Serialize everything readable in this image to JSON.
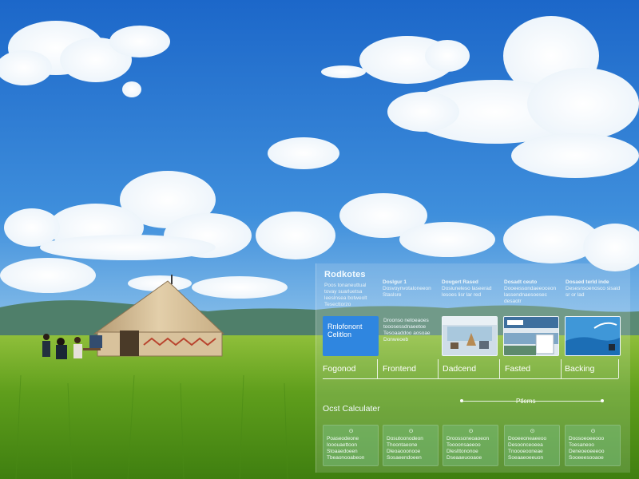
{
  "colors": {
    "sky_top": "#1f6fcf",
    "sky_bottom": "#8fc3ec",
    "grass": "#6aa81f",
    "panel_accent": "#2f86e0"
  },
  "scene": {
    "icons": [
      "yurt-icon",
      "people-icon",
      "cloud-icon"
    ]
  },
  "panel": {
    "title": "Rodkotes",
    "intro": "Poos tonaneuttual tovay suarluetsa leeslnsea botweolt Tesecttorzo",
    "stages": [
      {
        "head": "Doslgur 1",
        "desc": "Dosvoynvotaloneeon Staslsre",
        "card_text": "Rnlofonont Celitlon",
        "label": "Fogonod"
      },
      {
        "head": "Dovgert Rased",
        "desc": "Dosiuneleso laseerad lesoes lisr lar red",
        "card_text": "Droonso netoeaoes tooosessdnaeetoe Tesoaaddoo aosoae Donweoeb",
        "label": "Frontend"
      },
      {
        "head": "Dosadt ceuto",
        "desc": "Dooeessondaeeoceon lassendnaesoesec desaotr",
        "card_text": "",
        "label": "Dadcend"
      },
      {
        "head": "Dosaed terld inde",
        "desc": "Desesnsoenosco sisaid sr or lad",
        "card_text": "",
        "label": "Fasted"
      },
      {
        "head": "",
        "desc": "",
        "card_text": "",
        "label": "Backing"
      }
    ],
    "cost_title": "Ocst Calculater",
    "items_label": "Ptlems",
    "cost_items": [
      "Poaseodeone Iooouaettoon Stoaaedoeen Tbeaonooabeon",
      "Dosutoonodeon Thoontaeone Dleoaooonooe Sosaeendoeen",
      "Droossoneoaoeon Toooonsaeeoo Dleslttononoe Dseaaeuooaoe",
      "Dooeeoneaeeoo Desoonceoeea Tnoooeooneae Soeaaeoeeuon",
      "Doosoeoeeooo Toesaneoo Deneoeoeeeoo Sooeeesooaoe"
    ]
  }
}
